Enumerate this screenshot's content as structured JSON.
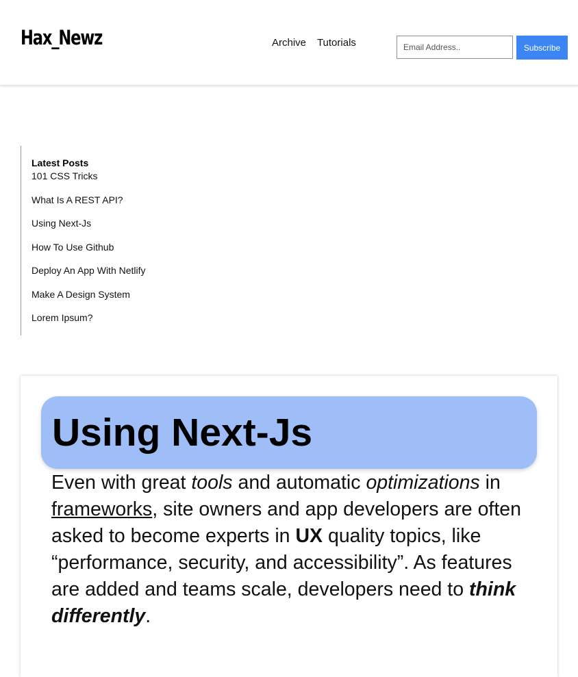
{
  "header": {
    "logo": "Hax_Newz",
    "nav": [
      "Archive",
      "Tutorials"
    ],
    "email_placeholder": "Email Address..",
    "subscribe_label": "Subscribe"
  },
  "sidebar": {
    "title": "Latest Posts",
    "items": [
      "101 CSS Tricks",
      "What Is A REST API?",
      "Using Next-Js",
      "How To Use Github",
      "Deploy An App With Netlify",
      "Make A Design System",
      "Lorem Ipsum?"
    ]
  },
  "post": {
    "title": "Using Next-Js",
    "body": {
      "t1": "Even with great ",
      "t2": "tools",
      "t3": " and automatic ",
      "t4": "optimizations",
      "t5": " in ",
      "t6": "frameworks",
      "t7": ", site owners and app developers are often asked to become experts in ",
      "t8": "UX",
      "t9": " quality topics, like “performance, security, and accessibility”. As features are added and teams scale, developers need to ",
      "t10": "think differently",
      "t11": "."
    }
  },
  "colors": {
    "accent": "#3b86f4",
    "title_background": "#9fbef8"
  }
}
